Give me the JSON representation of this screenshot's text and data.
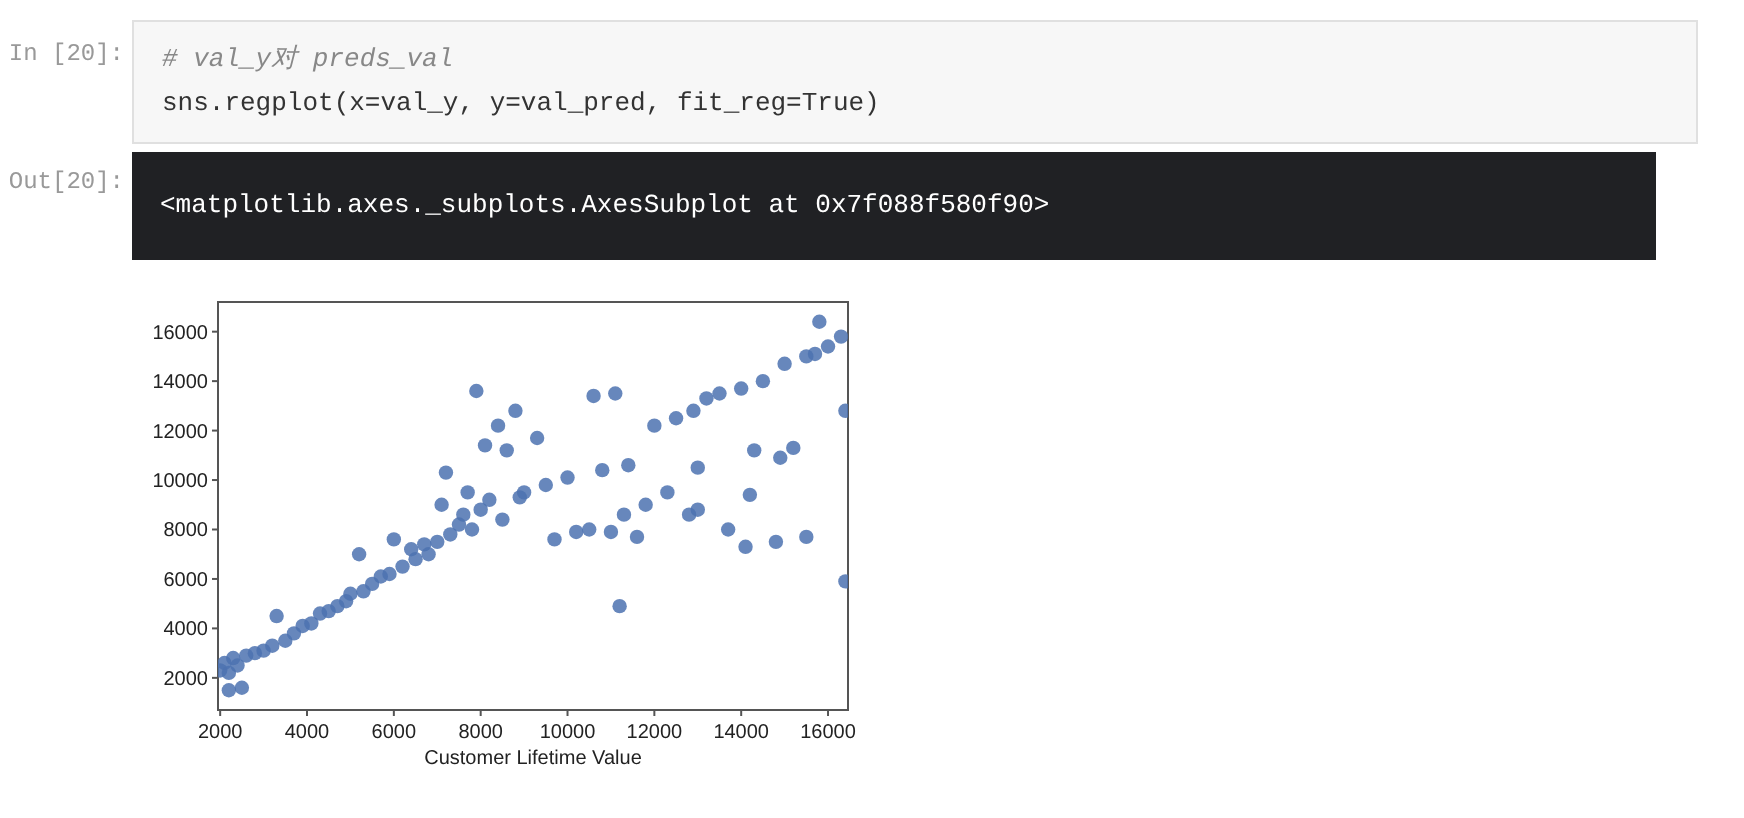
{
  "input_cell": {
    "prompt": "In [20]:",
    "lines": [
      {
        "kind": "comment",
        "text": "# val_y对 preds_val"
      },
      {
        "kind": "code",
        "text": "sns.regplot(x=val_y, y=val_pred, fit_reg=True)"
      }
    ]
  },
  "output_cell": {
    "prompt": "Out[20]:",
    "text": "<matplotlib.axes._subplots.AxesSubplot at 0x7f088f580f90>",
    "chart_data": {
      "type": "scatter",
      "xlabel": "Customer Lifetime Value",
      "xlim": [
        1950,
        16460
      ],
      "ylim": [
        700,
        17200
      ],
      "xticks": [
        2000,
        4000,
        6000,
        8000,
        10000,
        12000,
        14000,
        16000
      ],
      "yticks": [
        2000,
        4000,
        6000,
        8000,
        10000,
        12000,
        14000,
        16000
      ],
      "x": [
        2000,
        2100,
        2200,
        2300,
        2200,
        2500,
        2400,
        2600,
        2800,
        3000,
        3200,
        3300,
        3500,
        3700,
        3900,
        4100,
        4300,
        4500,
        4700,
        4900,
        5000,
        5200,
        5300,
        5500,
        5700,
        5900,
        6000,
        6200,
        6400,
        6500,
        6700,
        6800,
        7000,
        7100,
        7200,
        7300,
        7500,
        7600,
        7700,
        7800,
        7900,
        8000,
        8100,
        8200,
        8400,
        8500,
        8600,
        8800,
        8900,
        9000,
        9300,
        9500,
        9700,
        10000,
        10200,
        10500,
        10600,
        10800,
        11000,
        11100,
        11200,
        11300,
        11400,
        11600,
        11800,
        12000,
        12300,
        12500,
        12800,
        12900,
        13000,
        13000,
        13200,
        13500,
        13700,
        14000,
        14100,
        14200,
        14300,
        14500,
        14800,
        14900,
        15000,
        15200,
        15500,
        15500,
        15700,
        15800,
        16000,
        16300,
        16400,
        16400
      ],
      "series": [
        {
          "color": "#4c72b0",
          "values": [
            2300,
            2600,
            2200,
            2800,
            1500,
            1600,
            2500,
            2900,
            3000,
            3100,
            3300,
            4500,
            3500,
            3800,
            4100,
            4200,
            4600,
            4700,
            4900,
            5100,
            5400,
            7000,
            5500,
            5800,
            6100,
            6200,
            7600,
            6500,
            7200,
            6800,
            7400,
            7000,
            7500,
            9000,
            10300,
            7800,
            8200,
            8600,
            9500,
            8000,
            13600,
            8800,
            11400,
            9200,
            12200,
            8400,
            11200,
            12800,
            9300,
            9500,
            11700,
            9800,
            7600,
            10100,
            7900,
            8000,
            13400,
            10400,
            7900,
            13500,
            4900,
            8600,
            10600,
            7700,
            9000,
            12200,
            9500,
            12500,
            8600,
            12800,
            10500,
            8800,
            13300,
            13500,
            8000,
            13700,
            7300,
            9400,
            11200,
            14000,
            7500,
            10900,
            14700,
            11300,
            7700,
            15000,
            15100,
            16400,
            15400,
            15800,
            12800,
            5900
          ]
        }
      ]
    }
  }
}
